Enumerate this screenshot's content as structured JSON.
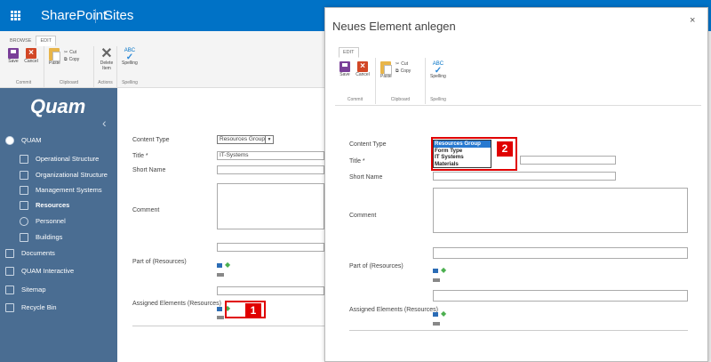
{
  "suitebar": {
    "brand": "SharePoint",
    "sites": "Sites"
  },
  "ribbon": {
    "tabs": [
      "BROWSE",
      "EDIT"
    ],
    "save": "Save",
    "cancel": "Cancel",
    "paste": "Paste",
    "cut": "Cut",
    "copy": "Copy",
    "delete": "Delete Item",
    "spelling": "Spelling",
    "spelling_icon": "ABC",
    "groups": {
      "commit": "Commit",
      "clipboard": "Clipboard",
      "actions": "Actions",
      "spelling": "Spelling"
    }
  },
  "leftnav": {
    "logo": "Quam",
    "items": [
      {
        "label": "QUAM",
        "icon": "quam-logo-icon"
      },
      {
        "label": "Operational Structure",
        "icon": "sitemap-icon"
      },
      {
        "label": "Organizational Structure",
        "icon": "org-chart-icon"
      },
      {
        "label": "Management Systems",
        "icon": "document-icon"
      },
      {
        "label": "Resources",
        "icon": "resources-icon"
      },
      {
        "label": "Personnel",
        "icon": "people-icon"
      },
      {
        "label": "Buildings",
        "icon": "building-icon"
      },
      {
        "label": "Documents",
        "icon": "documents-icon"
      },
      {
        "label": "QUAM Interactive",
        "icon": "interactive-icon"
      },
      {
        "label": "Sitemap",
        "icon": "sitemap-icon"
      },
      {
        "label": "Recycle Bin",
        "icon": "recycle-bin-icon"
      }
    ]
  },
  "form": {
    "content_type_label": "Content Type",
    "content_type_value": "Resources Group",
    "title_label": "Title *",
    "title_value": "IT-Systems",
    "short_name_label": "Short Name",
    "comment_label": "Comment",
    "part_of_label": "Part of (Resources)",
    "assigned_label": "Assigned Elements (Resources)"
  },
  "dialog": {
    "title": "Neues Element anlegen",
    "close": "×",
    "tab": "EDIT",
    "content_type_label": "Content Type",
    "content_type_options": [
      "Resources Group",
      "Form Type",
      "IT Systems",
      "Materials"
    ],
    "title_label": "Title *",
    "short_name_label": "Short Name",
    "comment_label": "Comment",
    "part_of_label": "Part of (Resources)",
    "assigned_label": "Assigned Elements (Resources)"
  },
  "annotations": {
    "one": "1",
    "two": "2"
  },
  "colors": {
    "suitebar": "#0072c6",
    "leftnav": "#4a6d92",
    "highlight": "#e00000",
    "selected_option": "#2879d0"
  }
}
